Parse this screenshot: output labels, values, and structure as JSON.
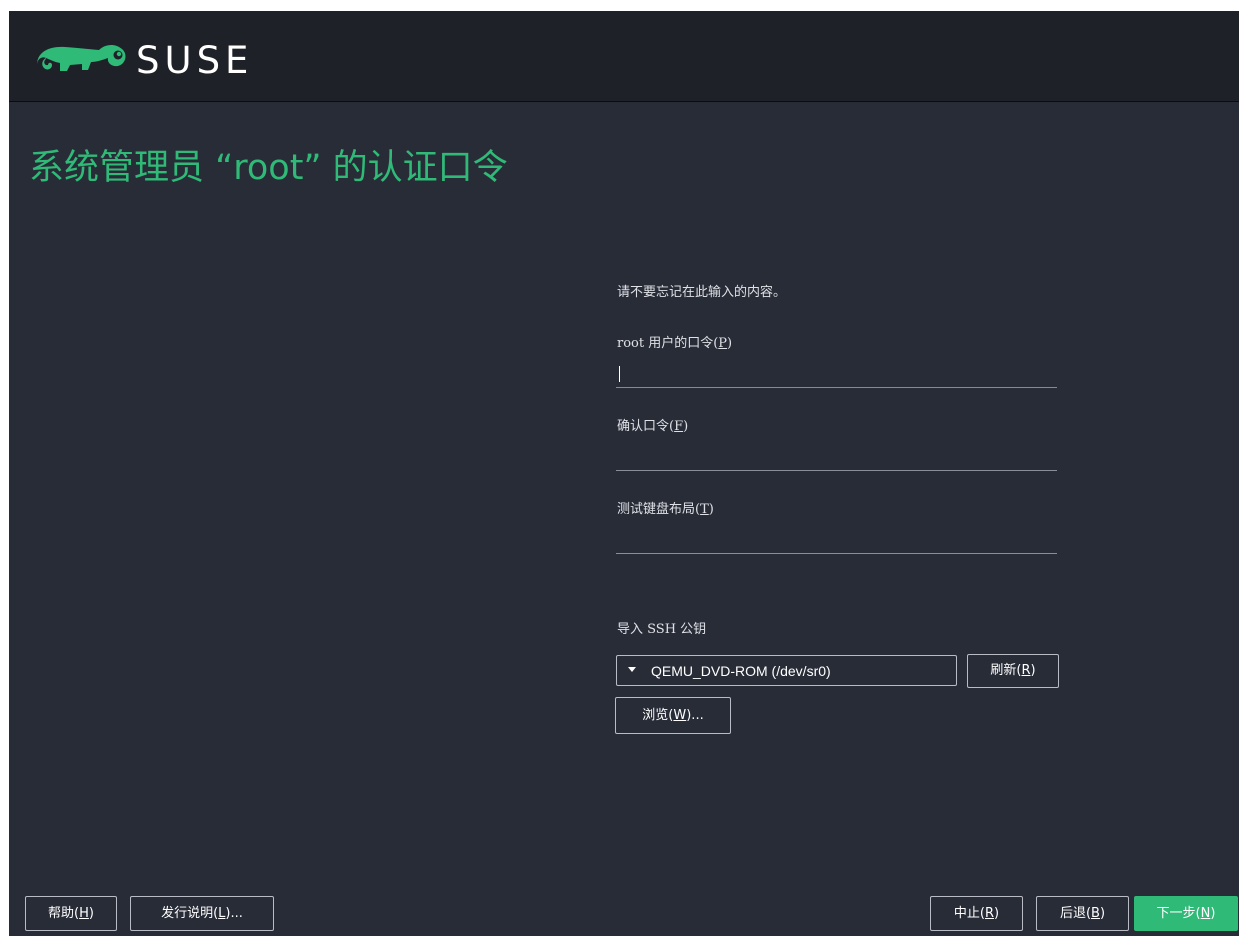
{
  "brand": {
    "name": "SUSE",
    "accent_color": "#30ba78"
  },
  "page": {
    "title": "系统管理员 “root” 的认证口令",
    "note": "请不要忘记在此输入的内容。"
  },
  "fields": [
    {
      "label": "root 用户的口令(",
      "key": "P",
      "suffix": ")",
      "value": "",
      "focused": true
    },
    {
      "label": "确认口令(",
      "key": "F",
      "suffix": ")",
      "value": "",
      "focused": false
    },
    {
      "label": "测试键盘布局(",
      "key": "T",
      "suffix": ")",
      "value": "",
      "focused": false
    }
  ],
  "ssh": {
    "label": "导入 SSH 公钥",
    "selected": "QEMU_DVD-ROM (/dev/sr0)",
    "refresh": {
      "label": "刷新(",
      "key": "R",
      "suffix": ")"
    },
    "browse": {
      "label": "浏览(",
      "key": "W",
      "suffix": ")..."
    }
  },
  "footer": {
    "help": {
      "label": "帮助(",
      "key": "H",
      "suffix": ")"
    },
    "release_notes": {
      "label": "发行说明(",
      "key": "L",
      "suffix": ")..."
    },
    "abort": {
      "label": "中止(",
      "key": "R",
      "suffix": ")"
    },
    "back": {
      "label": "后退(",
      "key": "B",
      "suffix": ")"
    },
    "next": {
      "label": "下一步(",
      "key": "N",
      "suffix": ")"
    }
  }
}
